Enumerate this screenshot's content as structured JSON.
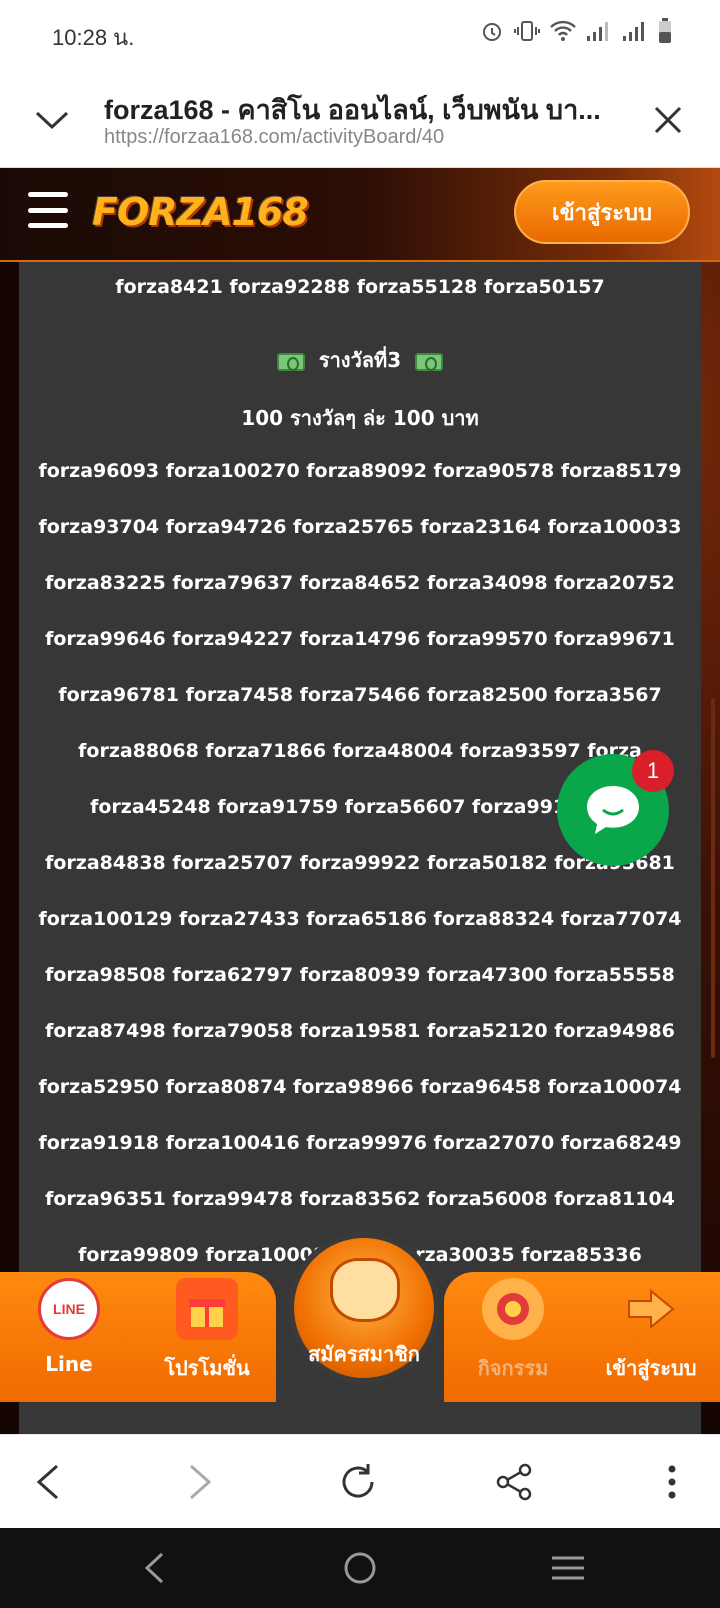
{
  "status_bar": {
    "time": "10:28 น."
  },
  "custom_tab": {
    "title": "forza168 - คาสิโน ออนไลน์, เว็บพนัน บา...",
    "url": "https://forzaa168.com/activityBoard/40"
  },
  "site_header": {
    "logo_text": "FORZA168",
    "login_label": "เข้าสู่ระบบ"
  },
  "content": {
    "top_line": "forza8421 forza92288 forza55128 forza50157",
    "prize_heading": "รางวัลที่3",
    "prize_detail": "100 รางวัลๆ ล่ะ 100 บาท",
    "winner_rows": [
      "forza96093 forza100270 forza89092 forza90578 forza85179",
      "forza93704 forza94726 forza25765 forza23164 forza100033",
      "forza83225 forza79637 forza84652 forza34098 forza20752",
      "forza99646 forza94227 forza14796 forza99570 forza99671",
      "forza96781 forza7458 forza75466 forza82500 forza3567",
      "forza88068 forza71866 forza48004 forza93597 forza",
      "forza45248 forza91759 forza56607 forza99166 for",
      "forza84838 forza25707 forza99922 forza50182 forza93681",
      "forza100129 forza27433 forza65186 forza88324 forza77074",
      "forza98508 forza62797 forza80939 forza47300 forza55558",
      "forza87498 forza79058 forza19581 forza52120 forza94986",
      "forza52950 forza80874 forza98966 forza96458 forza100074",
      "forza91918 forza100416 forza99976 forza27070 forza68249",
      "forza96351 forza99478 forza83562 forza56008 forza81104",
      "forza99809 forza100085 f 43 forza30035 forza85336"
    ]
  },
  "chat": {
    "badge_count": "1"
  },
  "site_nav": {
    "items": [
      {
        "label": "Line"
      },
      {
        "label": "โปรโมชั่น"
      },
      {
        "label": "สมัครสมาชิก"
      },
      {
        "label": "กิจกรรม"
      },
      {
        "label": "เข้าสู่ระบบ"
      }
    ]
  },
  "colors": {
    "accent_orange": "#f07a00",
    "panel_gray": "#373737",
    "chat_green": "#0aa64a",
    "badge_red": "#d9202a"
  },
  "icons": [
    "menu-icon",
    "chevron-down-icon",
    "close-icon",
    "chat-icon",
    "back-icon",
    "forward-icon",
    "reload-icon",
    "share-icon",
    "more-icon"
  ]
}
